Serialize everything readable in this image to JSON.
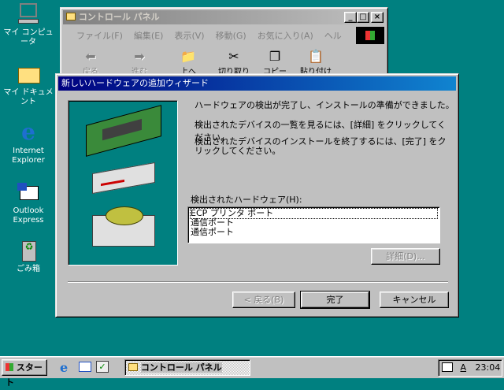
{
  "desktop": {
    "icons": [
      {
        "label": "マイ コンピュータ",
        "icon": "computer-icon"
      },
      {
        "label": "マイ ドキュメント",
        "icon": "folder-icon"
      },
      {
        "label": "Internet Explorer",
        "icon": "ie-icon"
      },
      {
        "label": "Outlook Express",
        "icon": "outlook-icon"
      },
      {
        "label": "ごみ箱",
        "icon": "recycle-bin-icon"
      }
    ]
  },
  "control_panel": {
    "title": "コントロール パネル",
    "menu": [
      "ファイル(F)",
      "編集(E)",
      "表示(V)",
      "移動(G)",
      "お気に入り(A)",
      "ヘル"
    ],
    "toolbar": [
      "戻る",
      "進む",
      "上へ",
      "切り取り",
      "コピー",
      "貼り付け"
    ]
  },
  "wizard": {
    "title": "新しいハードウェアの追加ウィザード",
    "text1": "ハードウェアの検出が完了し、インストールの準備ができました。",
    "text2": "検出されたデバイスの一覧を見るには、[詳細] をクリックしてください。",
    "text3": "検出されたデバイスのインストールを終了するには、[完了] をクリックしてください。",
    "list_label": "検出されたハードウェア(H):",
    "list_items": [
      "ECP プリンタ ポート",
      "通信ポート",
      "通信ポート"
    ],
    "details_button": "詳細(D)...",
    "back_button": "< 戻る(B)",
    "finish_button": "完了",
    "cancel_button": "キャンセル"
  },
  "taskbar": {
    "start": "スタート",
    "task": "コントロール パネル",
    "clock": "23:04",
    "ime": "A"
  },
  "colors": {
    "desktop": "#008080",
    "title_active": "#000080",
    "title_inactive": "#808080"
  }
}
